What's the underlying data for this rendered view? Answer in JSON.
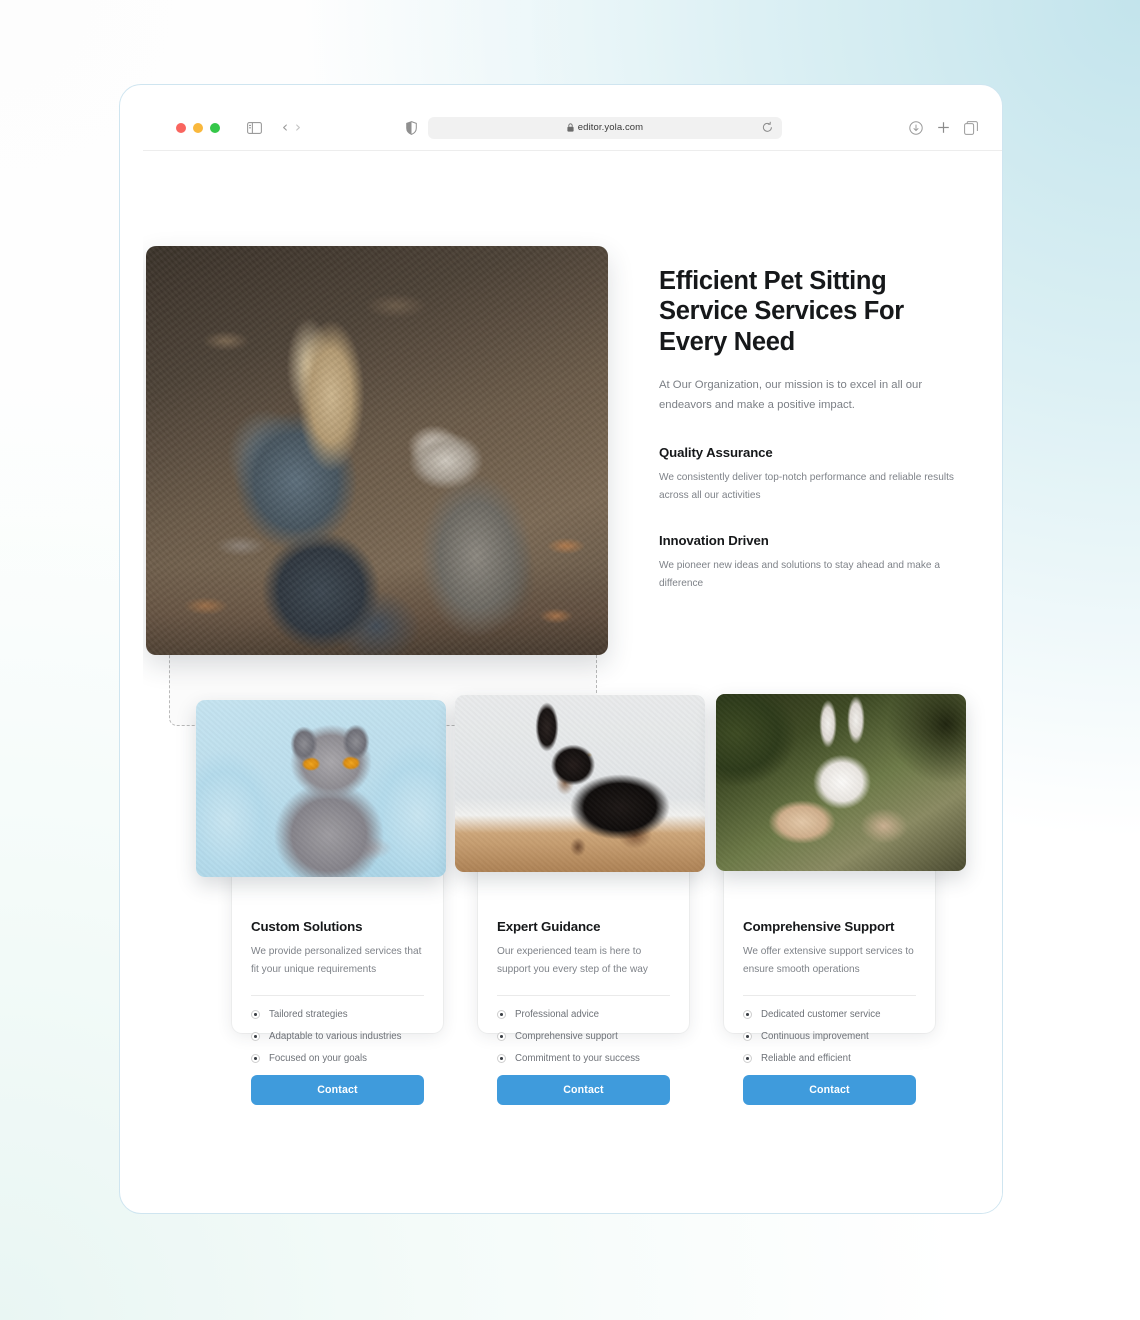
{
  "browser": {
    "url": "editor.yola.com",
    "traffic_lights": [
      "close",
      "minimize",
      "zoom"
    ],
    "back_label": "‹",
    "forward_label": "›",
    "colors": {
      "accent": "#3f9bdc",
      "window_border": "#cfe5f0"
    }
  },
  "hero": {
    "heading": "Efficient Pet Sitting Service Services For Every Need",
    "subheading": "At Our Organization, our mission is to excel in all our endeavors and make a positive impact.",
    "image_alt": "woman-sitting-with-dog-photo",
    "features": [
      {
        "title": "Quality Assurance",
        "body": "We consistently deliver top-notch performance and reliable results across all our activities"
      },
      {
        "title": "Innovation Driven",
        "body": "We pioneer new ideas and solutions to stay ahead and make a difference"
      }
    ]
  },
  "cards": [
    {
      "image_alt": "grey-scottish-fold-cat-photo",
      "title": "Custom Solutions",
      "description": "We provide personalized services that fit your unique requirements",
      "bullets": [
        "Tailored strategies",
        "Adaptable to various industries",
        "Focused on your goals"
      ],
      "button_label": "Contact"
    },
    {
      "image_alt": "black-dachshund-dog-photo",
      "title": "Expert Guidance",
      "description": "Our experienced team is here to support you every step of the way",
      "bullets": [
        "Professional advice",
        "Comprehensive support",
        "Commitment to your success"
      ],
      "button_label": "Contact"
    },
    {
      "image_alt": "white-rabbit-held-in-hands-photo",
      "title": "Comprehensive Support",
      "description": "We offer extensive support services to ensure smooth operations",
      "bullets": [
        "Dedicated customer service",
        "Continuous improvement",
        "Reliable and efficient"
      ],
      "button_label": "Contact"
    }
  ]
}
